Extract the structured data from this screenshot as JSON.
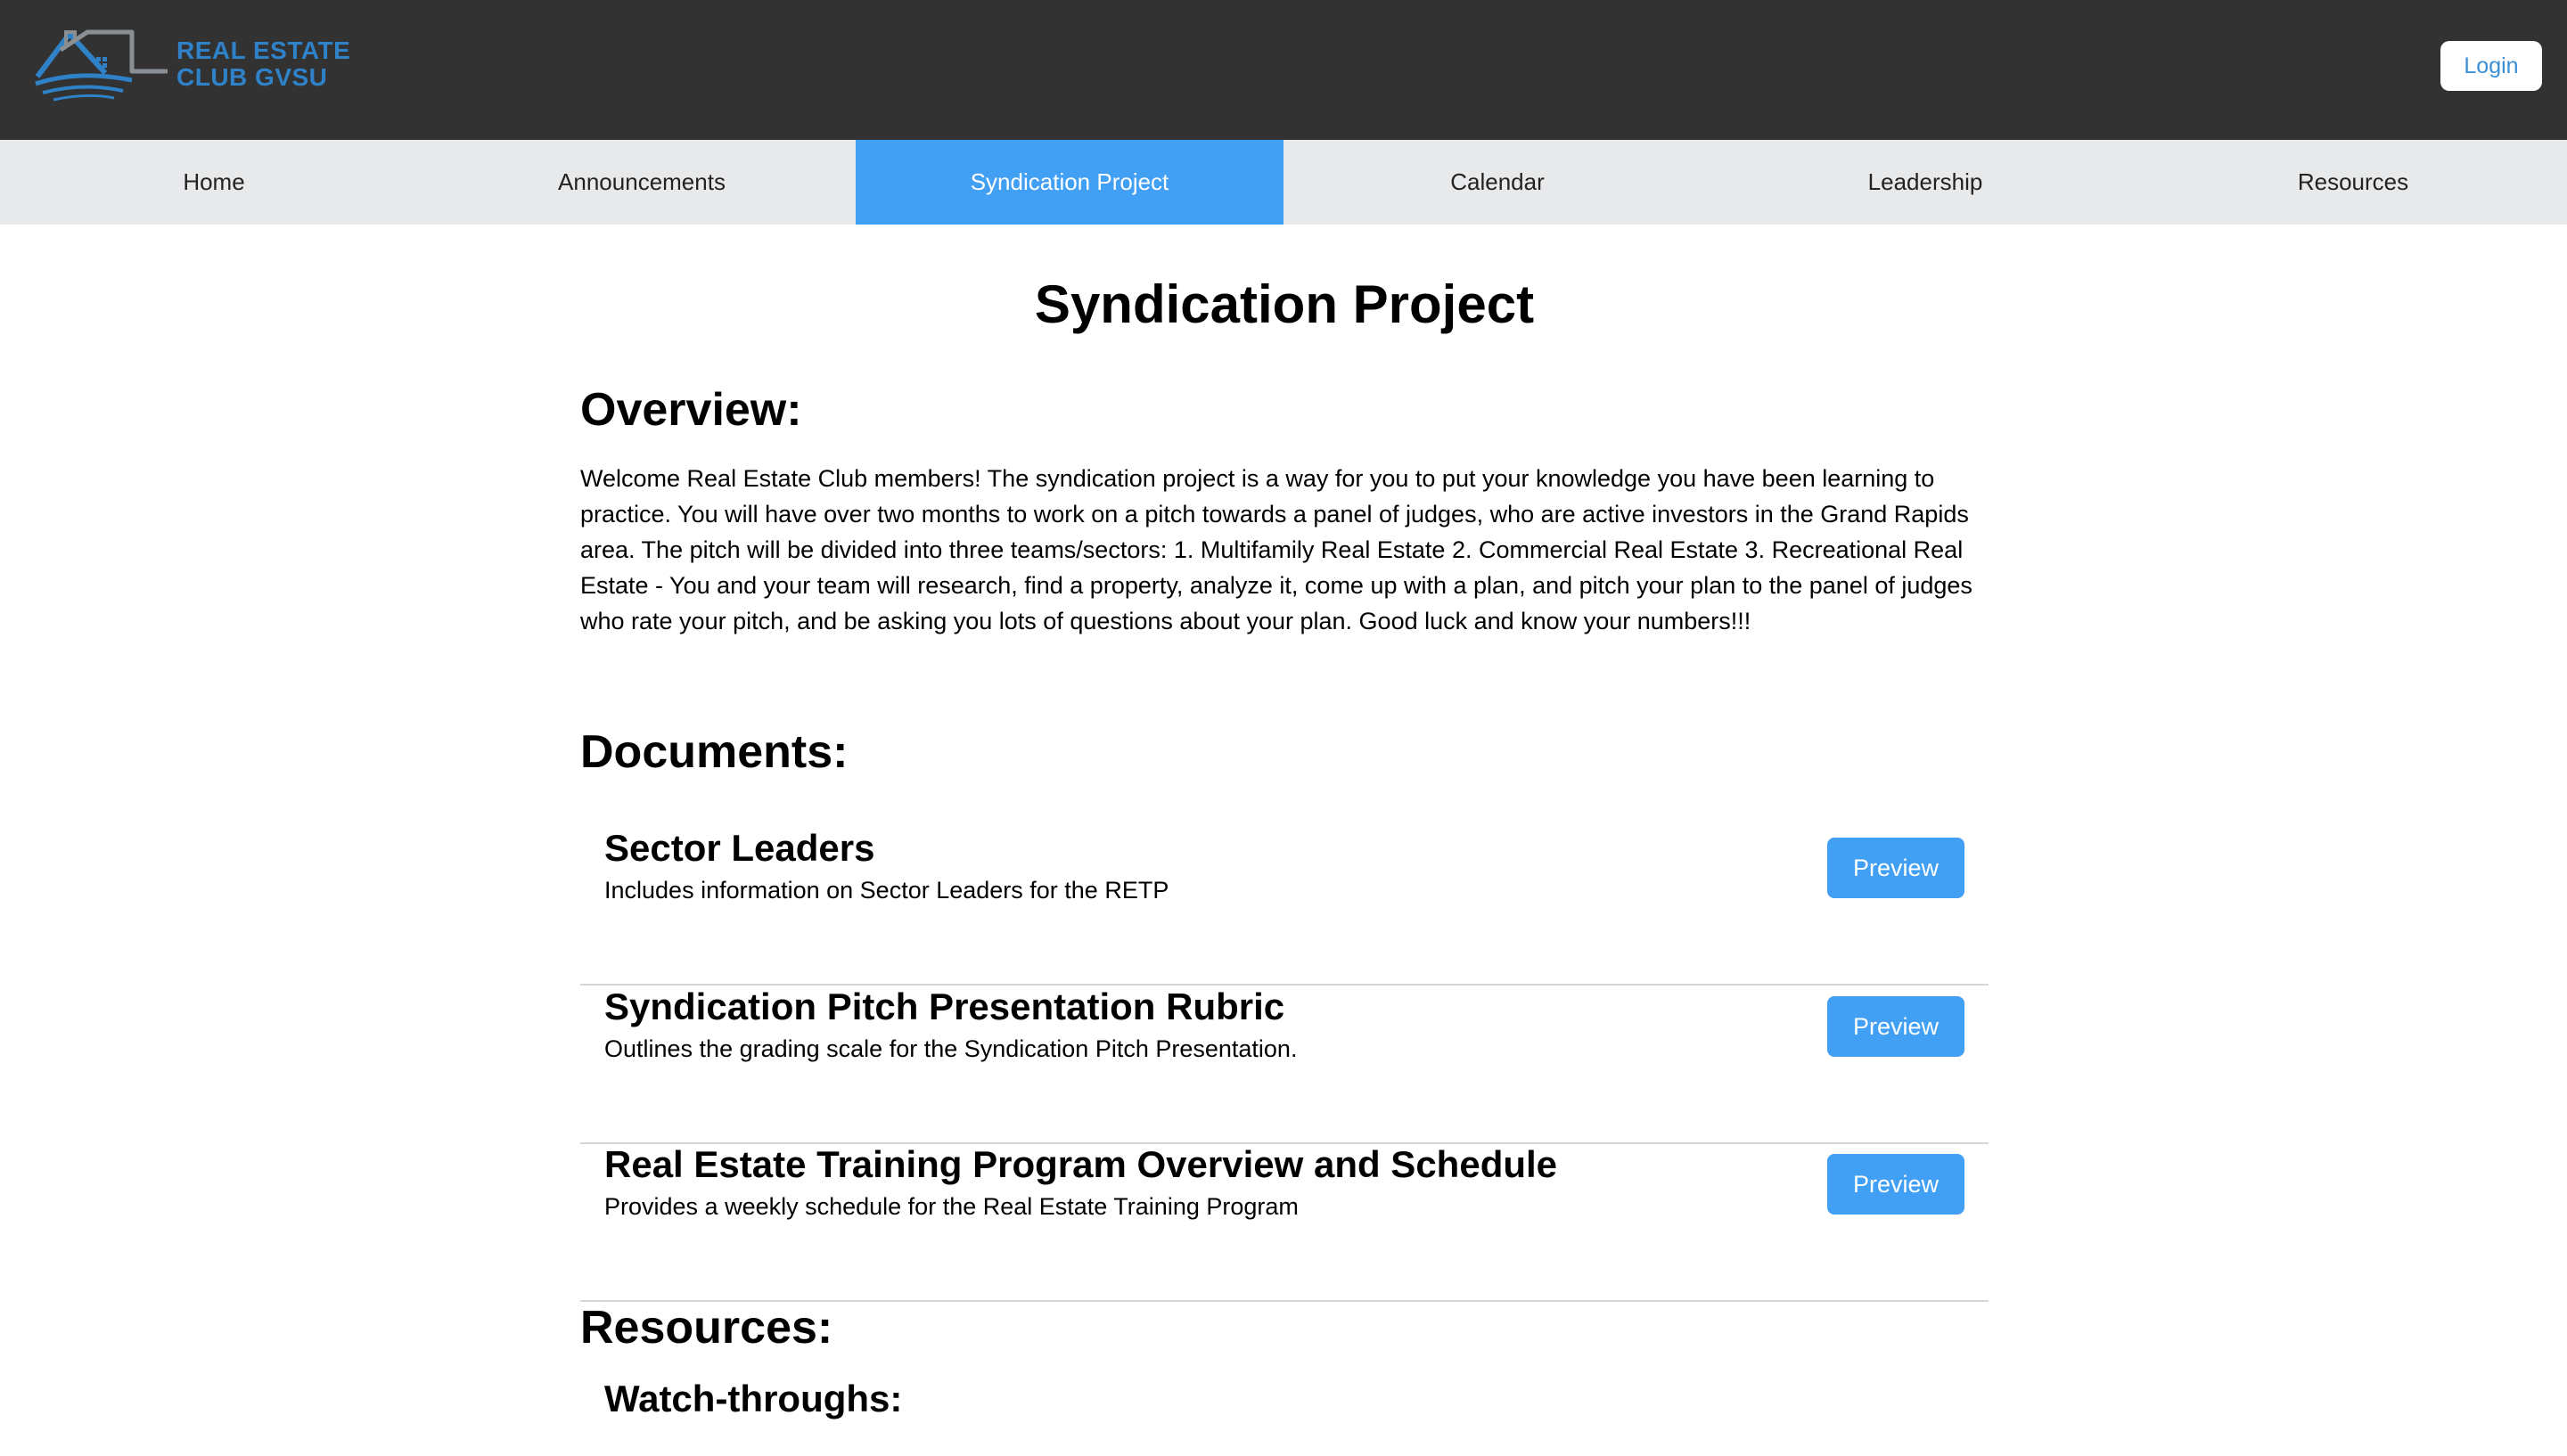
{
  "header": {
    "logo_line1": "REAL ESTATE",
    "logo_line2": "CLUB GVSU",
    "login_label": "Login"
  },
  "nav": {
    "items": [
      {
        "label": "Home"
      },
      {
        "label": "Announcements"
      },
      {
        "label": "Syndication Project"
      },
      {
        "label": "Calendar"
      },
      {
        "label": "Leadership"
      },
      {
        "label": "Resources"
      }
    ],
    "active": "Syndication Project"
  },
  "main": {
    "title": "Syndication Project",
    "overview_heading": "Overview:",
    "overview_text": "Welcome Real Estate Club members! The syndication project is a way for you to put your knowledge you have been learning to practice. You will have over two months to work on a pitch towards a panel of judges, who are active investors in the Grand Rapids area. The pitch will be divided into three teams/sectors: 1. Multifamily Real Estate 2. Commercial Real Estate 3. Recreational Real Estate - You and your team will research, find a property, analyze it, come up with a plan, and pitch your plan to the panel of judges who rate your pitch, and be asking you lots of questions about your plan. Good luck and know your numbers!!!",
    "documents_heading": "Documents:",
    "documents": [
      {
        "title": "Sector Leaders",
        "description": "Includes information on Sector Leaders for the RETP",
        "button": "Preview"
      },
      {
        "title": "Syndication Pitch Presentation Rubric",
        "description": "Outlines the grading scale for the Syndication Pitch Presentation.",
        "button": "Preview"
      },
      {
        "title": "Real Estate Training Program Overview and Schedule",
        "description": "Provides a weekly schedule for the Real Estate Training Program",
        "button": "Preview"
      }
    ],
    "resources_heading": "Resources:",
    "watch_heading": "Watch-throughs:"
  },
  "colors": {
    "header_bg": "#323232",
    "nav_bg": "#e8e9eb",
    "accent": "#42a0f4",
    "logo_blue": "#2f82c8"
  }
}
